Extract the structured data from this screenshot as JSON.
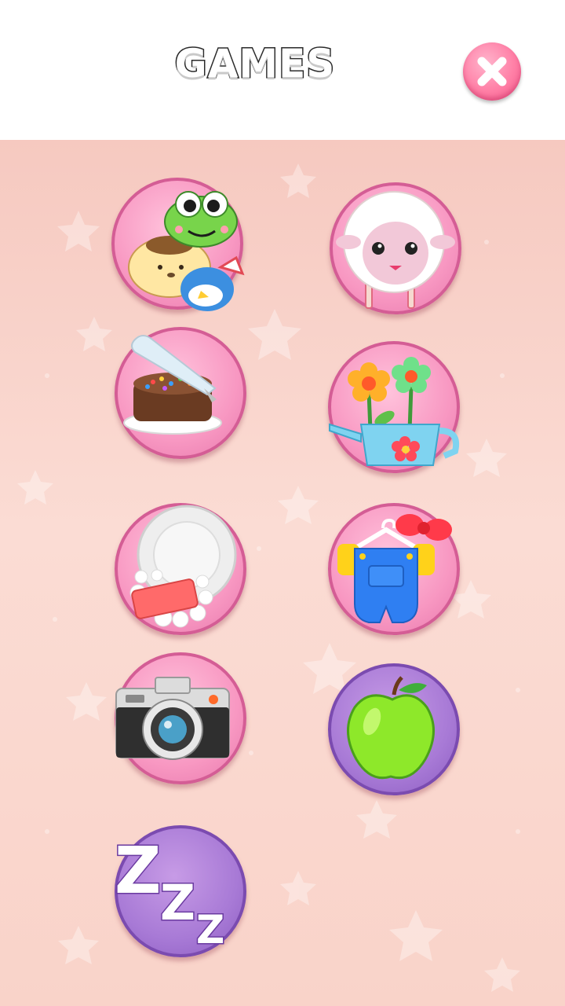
{
  "header": {
    "title": "GAMES",
    "close_icon": "close-icon"
  },
  "colors": {
    "background_top": "#f6c9c0",
    "background_bottom": "#fbdcd4",
    "button_pink": "#f898c2",
    "button_purple": "#a87ad6",
    "close_button": "#ff7fa6"
  },
  "games": [
    {
      "id": "friends",
      "icon": "character-friends-icon",
      "style": "pink"
    },
    {
      "id": "sheep",
      "icon": "sheep-icon",
      "style": "pink"
    },
    {
      "id": "cake",
      "icon": "cake-decorating-icon",
      "style": "pink"
    },
    {
      "id": "garden",
      "icon": "flowers-watering-can-icon",
      "style": "pink"
    },
    {
      "id": "dishes",
      "icon": "plate-soap-icon",
      "style": "pink"
    },
    {
      "id": "dress-up",
      "icon": "overalls-hanger-icon",
      "style": "pink"
    },
    {
      "id": "photo",
      "icon": "camera-icon",
      "style": "pink"
    },
    {
      "id": "food",
      "icon": "green-apple-icon",
      "style": "purple"
    },
    {
      "id": "sleep",
      "icon": "zzz-sleep-icon",
      "style": "purple"
    }
  ],
  "sleep_icon_text": {
    "big": "Z",
    "mid": "Z",
    "small": "Z"
  }
}
